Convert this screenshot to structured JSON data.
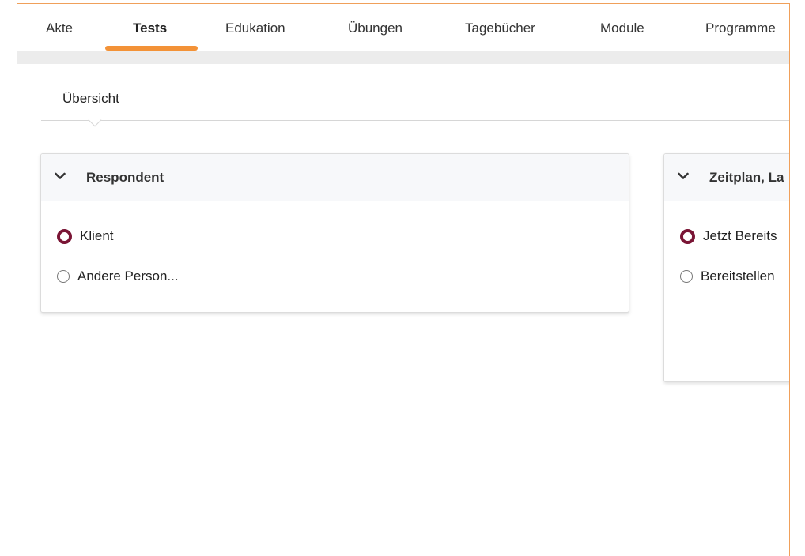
{
  "nav": {
    "tabs": [
      {
        "label": "Akte"
      },
      {
        "label": "Tests"
      },
      {
        "label": "Edukation"
      },
      {
        "label": "Übungen"
      },
      {
        "label": "Tagebücher"
      },
      {
        "label": "Module"
      },
      {
        "label": "Programme"
      }
    ],
    "active_index": 1
  },
  "subnav": {
    "label": "Übersicht"
  },
  "respondent_card": {
    "title": "Respondent",
    "options": [
      {
        "label": "Klient",
        "selected": true
      },
      {
        "label": "Andere Person...",
        "selected": false
      }
    ]
  },
  "schedule_card": {
    "title": "Zeitplan, La",
    "options": [
      {
        "label": "Jetzt Bereits",
        "selected": true
      },
      {
        "label": "Bereitstellen",
        "selected": false
      }
    ]
  },
  "colors": {
    "accent": "#f39237",
    "radio_selected": "#7a1535",
    "frame_border": "#f0a05a"
  }
}
